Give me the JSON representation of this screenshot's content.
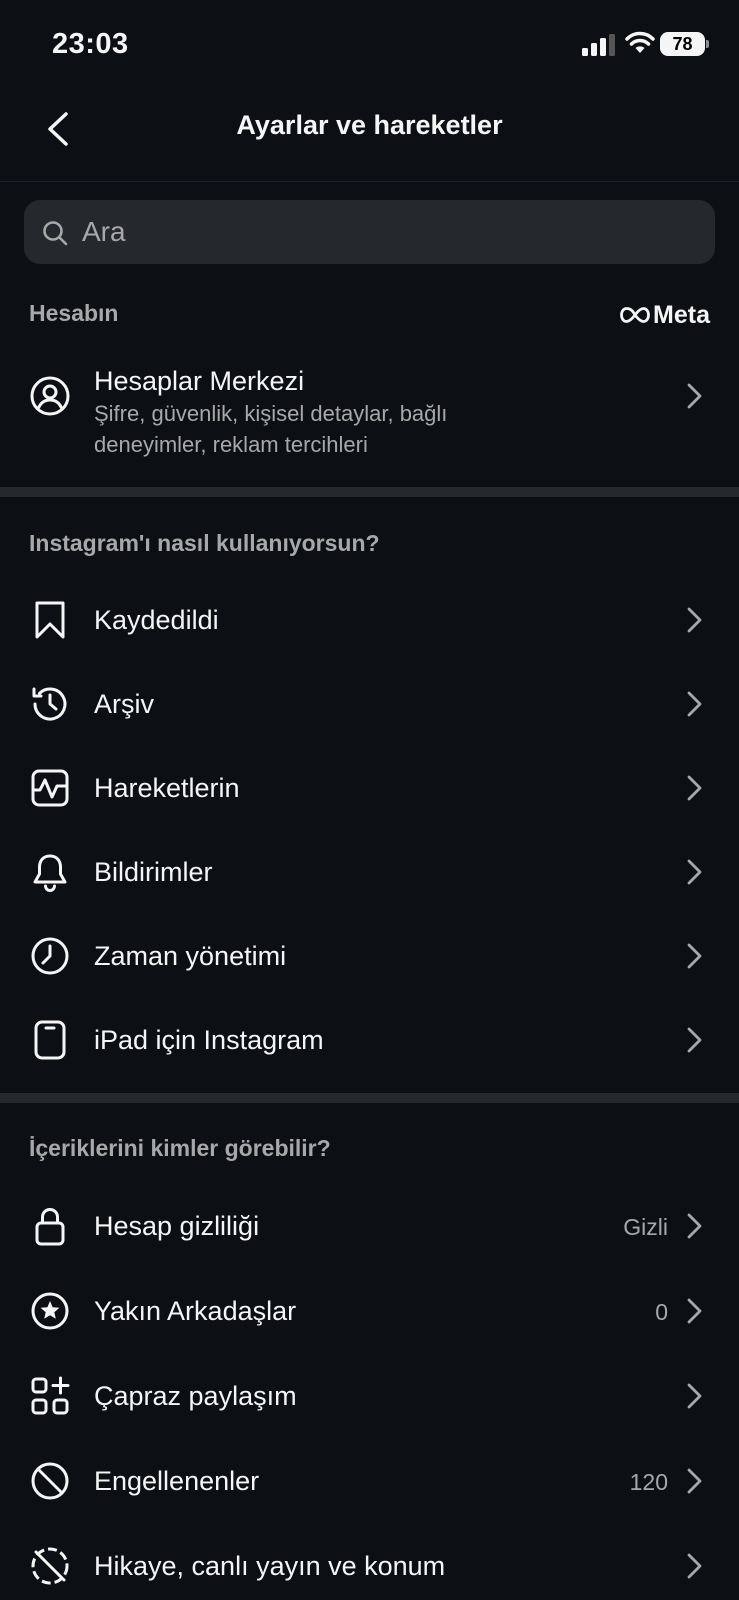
{
  "status": {
    "time": "23:03",
    "battery": "78"
  },
  "header": {
    "title": "Ayarlar ve hareketler"
  },
  "search": {
    "placeholder": "Ara"
  },
  "account_section": {
    "title": "Hesabın",
    "brand": "Meta",
    "item": {
      "label": "Hesaplar Merkezi",
      "subtitle_line1": "Şifre, güvenlik, kişisel detaylar, bağlı",
      "subtitle_line2": "deneyimler, reklam tercihleri"
    }
  },
  "usage_section": {
    "title": "Instagram'ı nasıl kullanıyorsun?",
    "items": [
      {
        "label": "Kaydedildi",
        "icon": "bookmark-icon"
      },
      {
        "label": "Arşiv",
        "icon": "archive-history-icon"
      },
      {
        "label": "Hareketlerin",
        "icon": "activity-icon"
      },
      {
        "label": "Bildirimler",
        "icon": "bell-icon"
      },
      {
        "label": "Zaman yönetimi",
        "icon": "clock-icon"
      },
      {
        "label": "iPad için Instagram",
        "icon": "tablet-icon"
      }
    ]
  },
  "privacy_section": {
    "title": "İçeriklerini kimler görebilir?",
    "items": [
      {
        "label": "Hesap gizliliği",
        "value": "Gizli",
        "icon": "lock-icon"
      },
      {
        "label": "Yakın Arkadaşlar",
        "value": "0",
        "icon": "star-circle-icon"
      },
      {
        "label": "Çapraz paylaşım",
        "value": "",
        "icon": "grid-plus-icon"
      },
      {
        "label": "Engellenenler",
        "value": "120",
        "icon": "blocked-icon"
      },
      {
        "label": "Hikaye, canlı yayın ve konum",
        "value": "",
        "icon": "story-location-off-icon"
      }
    ]
  },
  "colors": {
    "background": "#0c1014",
    "divider": "#25292e",
    "secondary_text": "#a8a8a8"
  }
}
